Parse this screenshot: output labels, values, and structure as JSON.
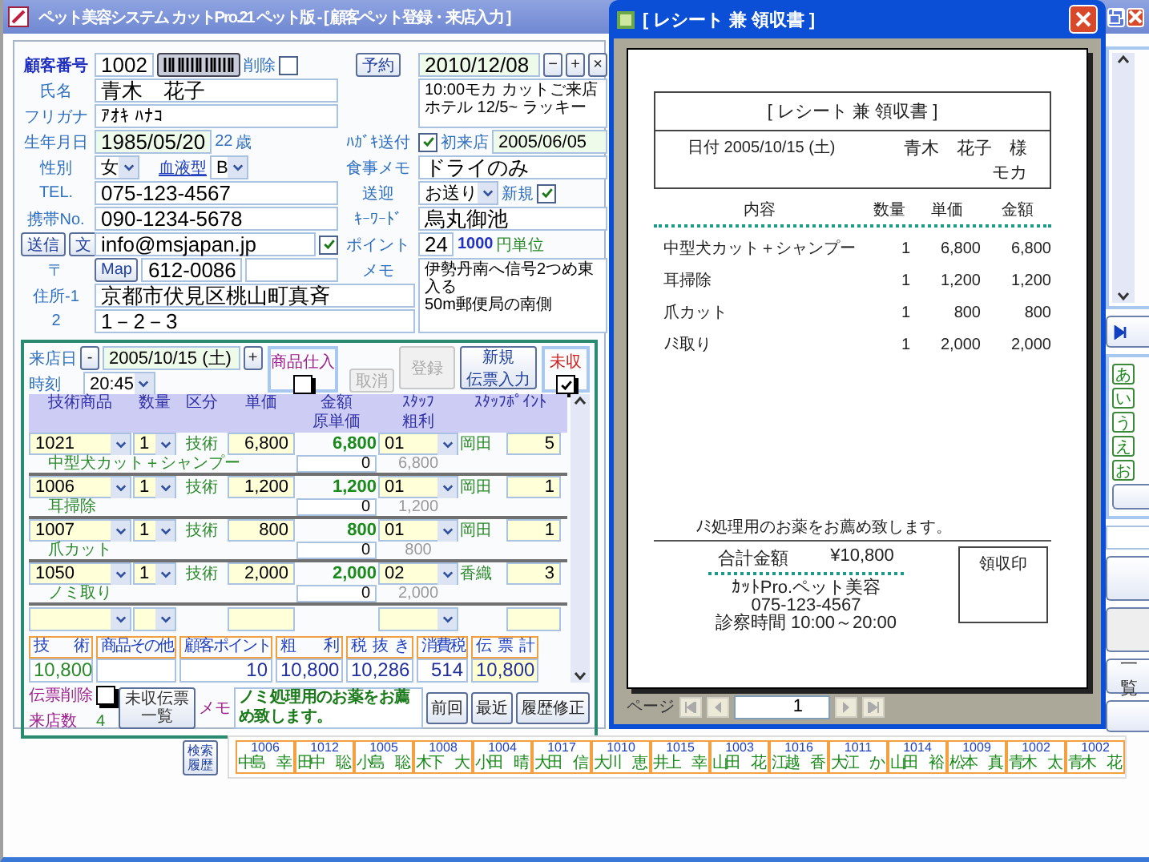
{
  "window": {
    "title": "ペット美容システム カットPro.21 ペット版 - [ 顧客ペット登録・来店入力 ]"
  },
  "customer": {
    "number": {
      "label": "顧客番号",
      "value": "1002"
    },
    "delete": {
      "label": "削除",
      "checked": false
    },
    "reservation": {
      "button": "予約",
      "date": "2010/12/08",
      "buttons": [
        "−",
        "+",
        "×"
      ]
    },
    "name": {
      "label": "氏名",
      "value": "青木　花子"
    },
    "note_lines": [
      "10:00モカ カットご来店",
      "ホテル 12/5~ ラッキー"
    ],
    "kana": {
      "label": "フリガナ",
      "value": "ｱｵｷ ﾊﾅｺ"
    },
    "birth": {
      "label": "生年月日",
      "value": "1985/05/20",
      "age": "22",
      "age_unit": "歳"
    },
    "postcard": {
      "label": "ﾊｶﾞｷ送付",
      "checked": true
    },
    "first_visit": {
      "label": "初来店",
      "value": "2005/06/05"
    },
    "sex": {
      "label": "性別",
      "value": "女"
    },
    "blood": {
      "label": "血液型",
      "value": "B"
    },
    "food": {
      "label": "食事メモ",
      "value": "ドライのみ"
    },
    "tel": {
      "label": "TEL.",
      "value": "075-123-4567"
    },
    "pickup": {
      "label": "送迎",
      "value": "お送り"
    },
    "new": {
      "label": "新規",
      "checked": true
    },
    "mobile": {
      "label": "携帯No.",
      "value": "090-1234-5678"
    },
    "keyword": {
      "label": "ｷｰﾜｰﾄﾞ",
      "value": "烏丸御池"
    },
    "send_buttons": [
      "送信",
      "文"
    ],
    "email": {
      "value": "info@msjapan.jp",
      "checked": true
    },
    "point": {
      "label": "ポイント",
      "value": "24",
      "unit_value": "1000",
      "unit": "円単位"
    },
    "zip": {
      "label": "〒",
      "button": "Map",
      "value": "612-0086"
    },
    "memo": {
      "label": "メモ",
      "lines": [
        "伊勢丹南へ信号2つめ東入る",
        "50m郵便局の南側"
      ]
    },
    "address1": {
      "label": "住所-1",
      "value": "京都市伏見区桃山町真斉"
    },
    "address2": {
      "label": "2",
      "value": "1－2－3"
    }
  },
  "visit": {
    "date": {
      "label": "来店日",
      "value": "2005/10/15 (土)",
      "buttons": [
        "-",
        "+"
      ]
    },
    "time": {
      "label": "時刻",
      "value": "20:45"
    },
    "stock": {
      "label": "商品仕入",
      "checked": false
    },
    "cancel_button": {
      "label": "取消",
      "disabled": true
    },
    "register_button": {
      "label": "登録",
      "disabled": true
    },
    "new_slip_button": {
      "lines": [
        "新規",
        "伝票入力"
      ]
    },
    "unpaid": {
      "label": "未収",
      "checked": true
    },
    "columns_top": [
      "技術商品",
      "数量",
      "区分",
      "単価",
      "金額",
      "ｽﾀｯﾌ",
      "ｽﾀｯﾌﾎﾟｲﾝﾄ"
    ],
    "columns_bottom": [
      "原単価",
      "粗利"
    ],
    "lines": [
      {
        "code": "1021",
        "qty": "1",
        "category": "技術",
        "unit_price": "6,800",
        "amount": "6,800",
        "staff_code": "01",
        "staff_name": "岡田",
        "points": "5",
        "name": "中型犬カット＋シャンプー",
        "cost": "0",
        "profit": "6,800"
      },
      {
        "code": "1006",
        "qty": "1",
        "category": "技術",
        "unit_price": "1,200",
        "amount": "1,200",
        "staff_code": "01",
        "staff_name": "岡田",
        "points": "1",
        "name": "耳掃除",
        "cost": "0",
        "profit": "1,200"
      },
      {
        "code": "1007",
        "qty": "1",
        "category": "技術",
        "unit_price": "800",
        "amount": "800",
        "staff_code": "01",
        "staff_name": "岡田",
        "points": "1",
        "name": "爪カット",
        "cost": "0",
        "profit": "800"
      },
      {
        "code": "1050",
        "qty": "1",
        "category": "技術",
        "unit_price": "2,000",
        "amount": "2,000",
        "staff_code": "02",
        "staff_name": "香織",
        "points": "3",
        "name": "ノミ取り",
        "cost": "0",
        "profit": "2,000"
      }
    ],
    "totals": [
      {
        "label": "技術",
        "value": "10,800"
      },
      {
        "label": "商品その他"
      },
      {
        "label": "顧客ポイント",
        "value": "10"
      },
      {
        "label": "粗利",
        "value": "10,800"
      },
      {
        "label": "税抜き",
        "value": "10,286"
      },
      {
        "label": "消費税",
        "value": "514"
      },
      {
        "label": "伝票計",
        "value": "10,800"
      }
    ],
    "slip_delete": {
      "label": "伝票削除",
      "checked": false
    },
    "visit_count": {
      "label": "来店数",
      "value": "4"
    },
    "unpaid_list_button": [
      "未収伝票",
      "一覧"
    ],
    "memo_label": "メモ",
    "memo": "ノミ処理用のお薬をお薦め致します。",
    "nav_buttons": [
      "前回",
      "最近",
      "履歴修正"
    ]
  },
  "history": {
    "button": [
      "検索",
      "履歴"
    ],
    "items": [
      {
        "code": "1006",
        "name": "中島　幸"
      },
      {
        "code": "1012",
        "name": "田中　聡"
      },
      {
        "code": "1005",
        "name": "小島　聡"
      },
      {
        "code": "1008",
        "name": "木下　大"
      },
      {
        "code": "1004",
        "name": "小田　晴"
      },
      {
        "code": "1017",
        "name": "大田　信"
      },
      {
        "code": "1010",
        "name": "大川　恵"
      },
      {
        "code": "1015",
        "name": "井上　幸"
      },
      {
        "code": "1003",
        "name": "山田　花"
      },
      {
        "code": "1016",
        "name": "江越　香"
      },
      {
        "code": "1011",
        "name": "大江　か"
      },
      {
        "code": "1014",
        "name": "山田　裕"
      },
      {
        "code": "1009",
        "name": "松本　真"
      },
      {
        "code": "1002",
        "name": "青木　太"
      },
      {
        "code": "1002",
        "name": "青木　花"
      }
    ]
  },
  "side_panel": {
    "kana_buttons": [
      "あ",
      "い",
      "う",
      "え",
      "お"
    ],
    "list_button": "一覧"
  },
  "receipt": {
    "window_title": "[ レシート 兼 領収書 ]",
    "heading": "[ レシート 兼 領収書 ]",
    "date": "日付 2005/10/15 (土)",
    "customer": "青木　花子　様",
    "pet": "モカ",
    "columns": [
      "内容",
      "数量",
      "単価",
      "金額"
    ],
    "items": [
      {
        "name": "中型犬カット＋シャンプー",
        "qty": "1",
        "price": "6,800",
        "amount": "6,800"
      },
      {
        "name": "耳掃除",
        "qty": "1",
        "price": "1,200",
        "amount": "1,200"
      },
      {
        "name": "爪カット",
        "qty": "1",
        "price": "800",
        "amount": "800"
      },
      {
        "name": "ﾉﾐ取り",
        "qty": "1",
        "price": "2,000",
        "amount": "2,000"
      }
    ],
    "message": "ﾉﾐ処理用のお薬をお薦め致します。",
    "total_label": "合計金額",
    "total": "¥10,800",
    "shop_lines": [
      "ｶｯﾄPro.ペット美容",
      "075-123-4567",
      "診察時間 10:00～20:00"
    ],
    "stamp_label": "領収印",
    "pager": {
      "label": "ページ",
      "page": "1"
    }
  }
}
